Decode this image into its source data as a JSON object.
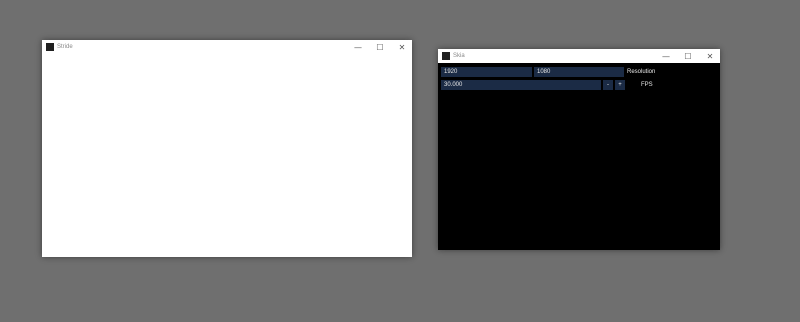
{
  "windows": {
    "stride": {
      "title": "Stride",
      "controls": {
        "minimize": "—",
        "maximize": "☐",
        "close": "✕"
      }
    },
    "skia": {
      "title": "Skia",
      "controls": {
        "minimize": "—",
        "maximize": "☐",
        "close": "✕"
      },
      "resolution": {
        "width": "1920",
        "height": "1080",
        "label": "Resolution"
      },
      "fps": {
        "value": "30.000",
        "decrement": "-",
        "increment": "+",
        "label": "FPS"
      }
    }
  },
  "colors": {
    "desktop": "#6f6f6f",
    "field_bg": "#1b2b45",
    "skia_bg": "#000000"
  }
}
